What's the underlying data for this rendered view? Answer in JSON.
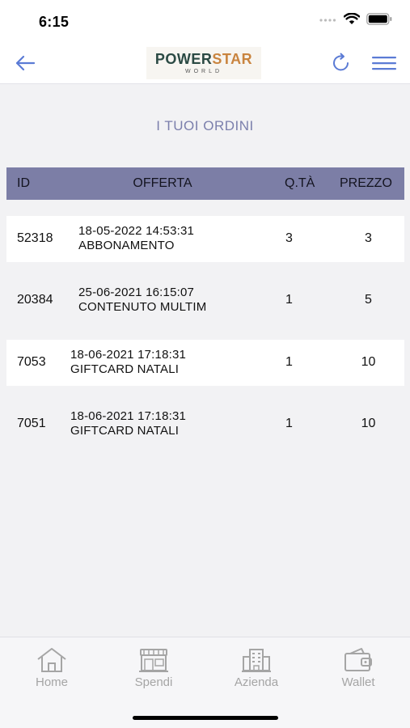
{
  "status": {
    "time": "6:15"
  },
  "header": {
    "logo_main_1": "POWER",
    "logo_main_2": "STAR",
    "logo_sub": "WORLD"
  },
  "page": {
    "title": "I TUOI ORDINI"
  },
  "table": {
    "headers": {
      "id": "ID",
      "offer": "OFFERTA",
      "qty": "Q.TÀ",
      "price": "PREZZO"
    },
    "rows": [
      {
        "id": "52318",
        "date": "18-05-2022 14:53:31",
        "offer": "ABBONAMENTO",
        "qty": "3",
        "price": "3"
      },
      {
        "id": "20384",
        "date": "25-06-2021 16:15:07",
        "offer": "CONTENUTO MULTIM",
        "qty": "1",
        "price": "5"
      },
      {
        "id": "7053",
        "date": "18-06-2021 17:18:31",
        "offer": "GIFTCARD NATALI",
        "qty": "1",
        "price": "10"
      },
      {
        "id": "7051",
        "date": "18-06-2021 17:18:31",
        "offer": "GIFTCARD NATALI",
        "qty": "1",
        "price": "10"
      }
    ]
  },
  "tabs": [
    {
      "label": "Home",
      "icon": "home-icon"
    },
    {
      "label": "Spendi",
      "icon": "shop-icon"
    },
    {
      "label": "Azienda",
      "icon": "building-icon"
    },
    {
      "label": "Wallet",
      "icon": "wallet-icon"
    }
  ],
  "colors": {
    "accent": "#5b7bd5",
    "header_bg": "#7c7ea6",
    "title": "#7b7fac",
    "tab_inactive": "#a5a5a5"
  }
}
